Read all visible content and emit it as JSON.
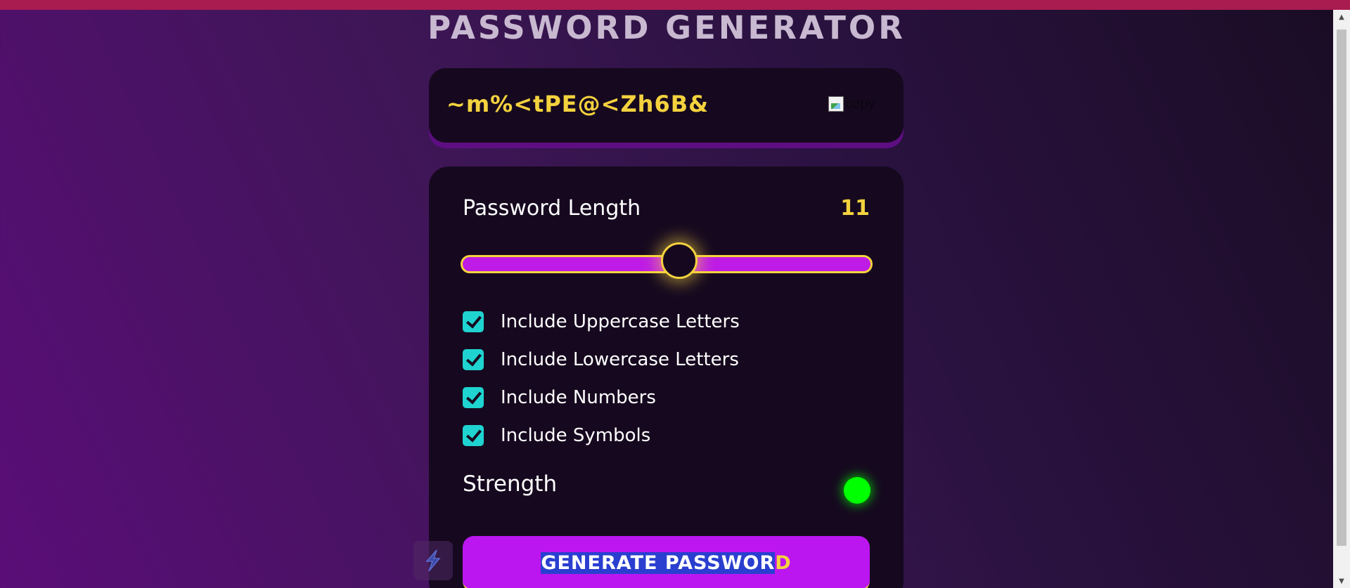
{
  "app": {
    "title": "PASSWORD GENERATOR"
  },
  "password": {
    "value": "~m%<tPE@<Zh6B&",
    "copy_alt": "copy"
  },
  "length": {
    "label": "Password Length",
    "value": "11",
    "min": 0,
    "max": 20,
    "slider_fraction": 0.53
  },
  "options": [
    {
      "label": "Include Uppercase Letters",
      "checked": true
    },
    {
      "label": "Include Lowercase Letters",
      "checked": true
    },
    {
      "label": "Include Numbers",
      "checked": true
    },
    {
      "label": "Include Symbols",
      "checked": true
    }
  ],
  "strength": {
    "label": "Strength",
    "indicator_color": "#00ff00"
  },
  "generate": {
    "label_selected": "GENERATE PASSWOR",
    "label_rest": "D"
  },
  "colors": {
    "accent_yellow": "#f4d23e",
    "accent_purple": "#bb16f0",
    "checkbox_cyan": "#1fd3d0",
    "panel_bg": "#16091f"
  },
  "icons": {
    "copy": "broken-image-icon",
    "extension": "lightning-bolt-icon",
    "checkbox": "checkmark-icon"
  }
}
